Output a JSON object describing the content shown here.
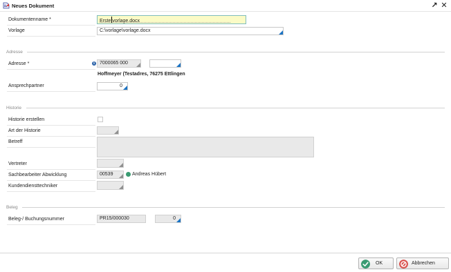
{
  "window": {
    "title": "Neues Dokument",
    "expand_icon": "↗",
    "close_icon": "✕"
  },
  "form": {
    "dokumentenname": {
      "label": "Dokumentenname *",
      "value_before_caret": "Erste",
      "value_after_caret": "vorlage.docx"
    },
    "vorlage": {
      "label": "Vorlage",
      "value": "C:\\vorlage\\vorlage.docx"
    }
  },
  "adresse_section": {
    "title": "Adresse",
    "adresse": {
      "label": "Adresse *",
      "value": "7000065 000",
      "extra_value": "",
      "address_text": "Hoffmeyer (Testadres, 76275 Ettlingen"
    },
    "ansprechpartner": {
      "label": "Ansprechpartner",
      "value": "0"
    }
  },
  "historie_section": {
    "title": "Historie",
    "historie_erstellen": {
      "label": "Historie erstellen",
      "checked": false
    },
    "art_der_historie": {
      "label": "Art der Historie",
      "value": ""
    },
    "betreff": {
      "label": "Betreff",
      "value": ""
    },
    "vertreter": {
      "label": "Vertreter",
      "value": ""
    },
    "sachbearbeiter": {
      "label": "Sachbearbeiter Abwicklung",
      "value": "00539",
      "name": "Andreas Hübert",
      "status_color": "#3a9b72"
    },
    "kundendiensttechniker": {
      "label": "Kundendiensttechniker",
      "value": ""
    }
  },
  "beleg_section": {
    "title": "Beleg",
    "belegnummer": {
      "label": "Beleg-/ Buchungsnummer",
      "value": "PR15/000030",
      "position": "0"
    }
  },
  "footer": {
    "ok_label": "OK",
    "cancel_label": "Abbrechen",
    "ok_color": "#3a9b72",
    "cancel_color": "#d9534f"
  }
}
